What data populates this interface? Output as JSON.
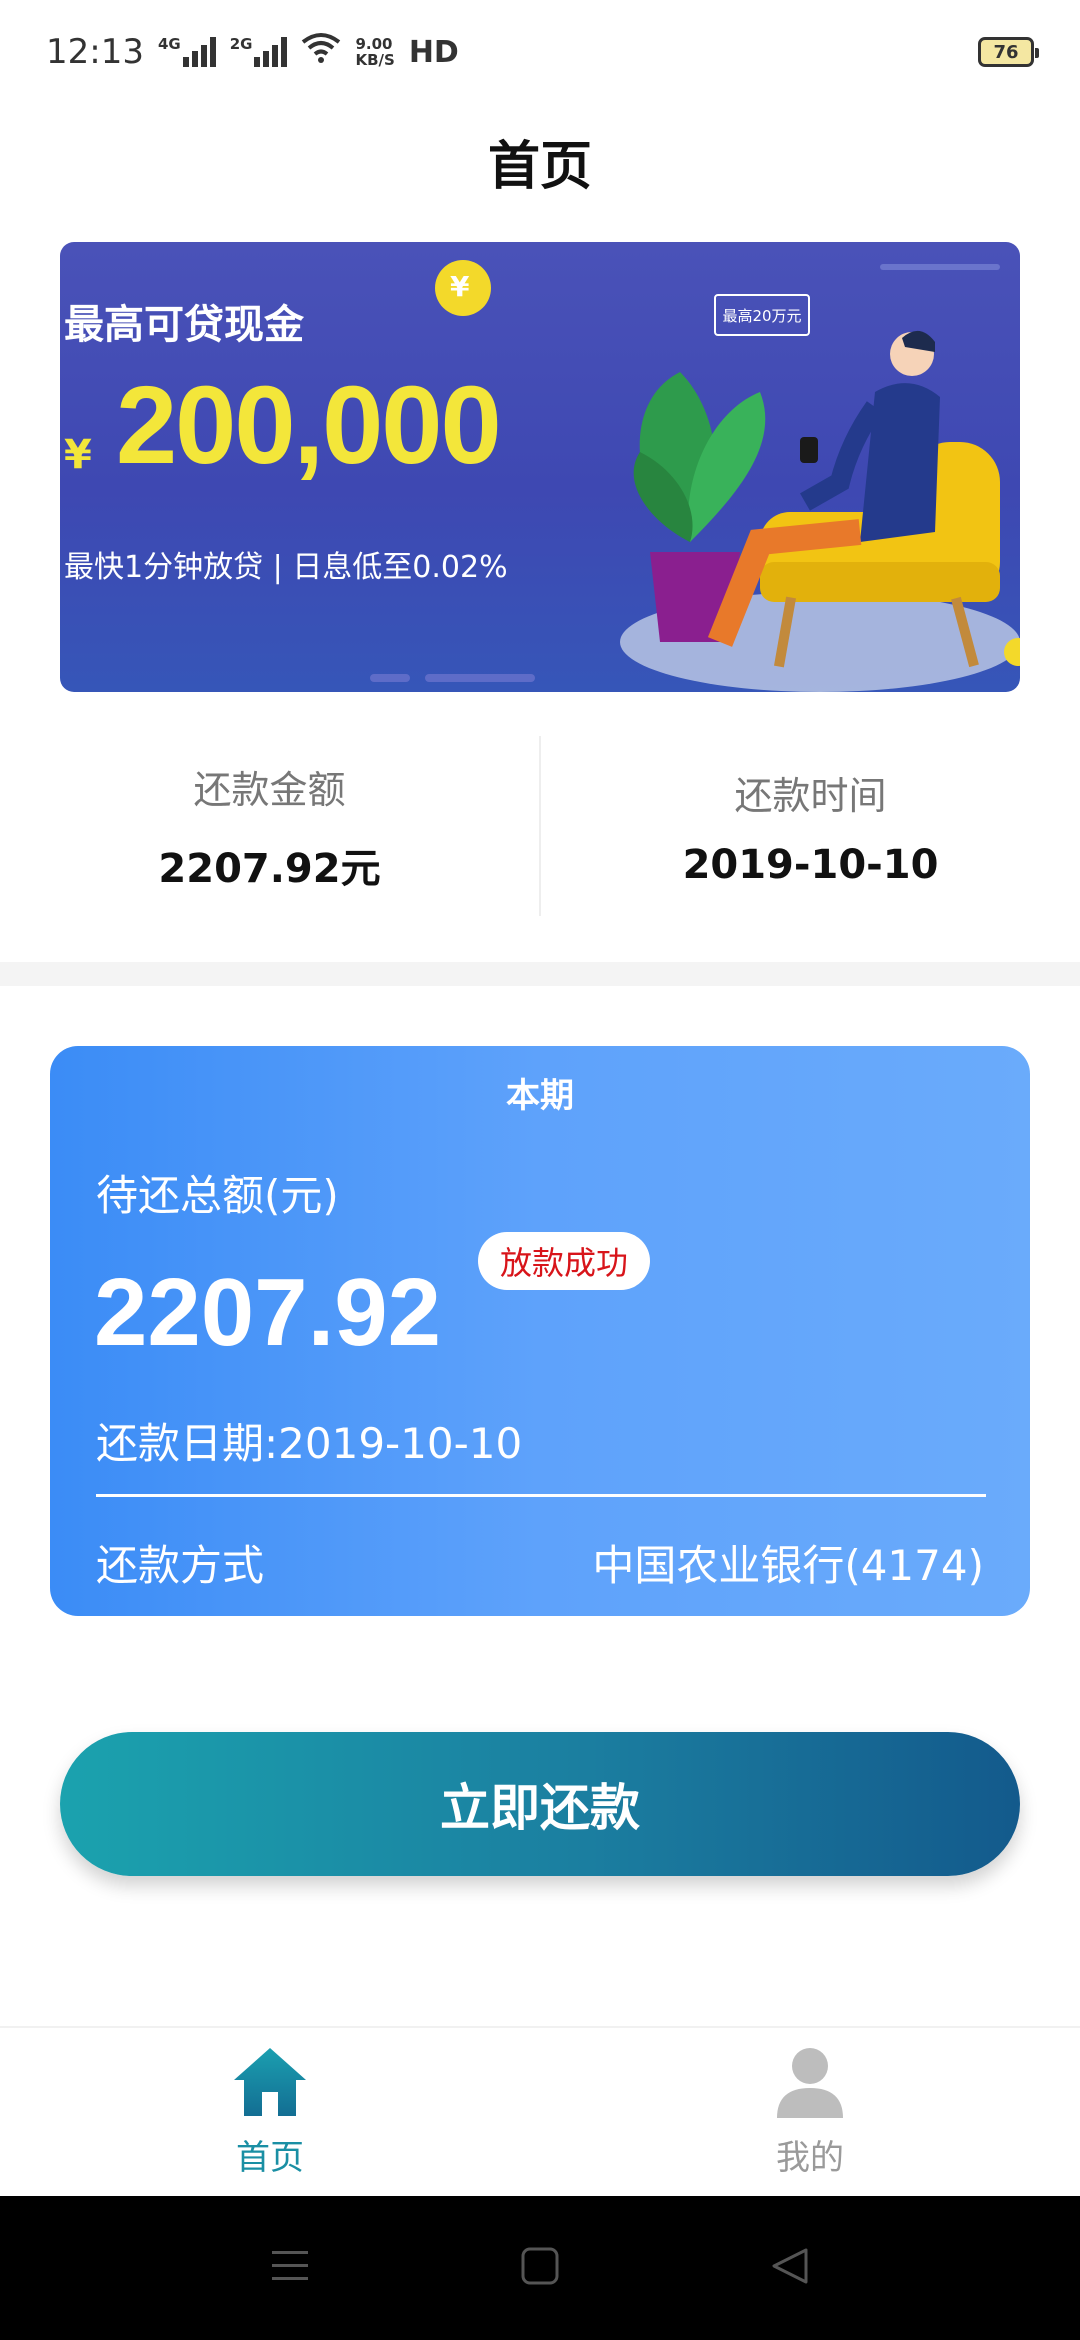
{
  "status_bar": {
    "time": "12:13",
    "sim1_label": "4G",
    "sim2_label": "2G",
    "speed_value": "9.00",
    "speed_unit": "KB/S",
    "hd_label": "HD",
    "battery": "76"
  },
  "header": {
    "title": "首页"
  },
  "banner": {
    "headline": "最高可贷现金",
    "currency": "¥",
    "amount": "200,000",
    "subtitle": "最快1分钟放贷 | 日息低至0.02%",
    "tag": "最高20万元",
    "coin_symbol": "¥"
  },
  "summary": {
    "amount_label": "还款金额",
    "amount_value": "2207.92元",
    "date_label": "还款时间",
    "date_value": "2019-10-10"
  },
  "card": {
    "period": "本期",
    "total_label": "待还总额(元)",
    "amount": "2207.92",
    "badge": "放款成功",
    "due": "还款日期:2019-10-10",
    "method_label": "还款方式",
    "method_value": "中国农业银行(4174)"
  },
  "primary_button": {
    "label": "立即还款"
  },
  "tabbar": {
    "items": [
      {
        "label": "首页",
        "icon": "home-icon",
        "active": true
      },
      {
        "label": "我的",
        "icon": "user-icon",
        "active": false
      }
    ]
  },
  "colors": {
    "accent": "#1a8fa4",
    "card_start": "#3b8cf6",
    "card_end": "#6aabfb",
    "badge_text": "#d8141a",
    "banner_yellow": "#f3e63a"
  }
}
